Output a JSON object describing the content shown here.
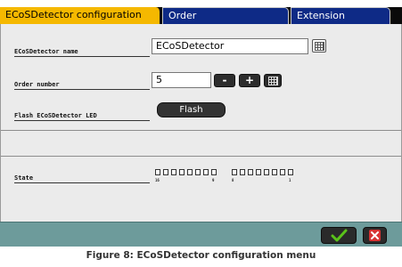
{
  "tabs": [
    {
      "label": "ECoSDetector configuration",
      "active": true
    },
    {
      "label": "Order",
      "active": false
    },
    {
      "label": "Extension",
      "active": false
    }
  ],
  "fields": {
    "name": {
      "label": "ECoSDetector name",
      "value": "ECoSDetector"
    },
    "order": {
      "label": "Order number",
      "value": "5"
    },
    "flash": {
      "label": "Flash ECoSDetector LED",
      "button_label": "Flash"
    },
    "state": {
      "label": "State",
      "led_count": 16,
      "numbers": [
        "16",
        "9",
        "8",
        "1"
      ]
    }
  },
  "buttons": {
    "minus": "-",
    "plus": "+"
  },
  "caption": "Figure 8: ECoSDetector configuration menu",
  "colors": {
    "active_tab": "#f5b800",
    "inactive_tab": "#0e2a86",
    "panel": "#ebebeb",
    "bottom_bar": "#6d9b9b",
    "ok_check": "#5ac21a",
    "cancel_x": "#d63232"
  },
  "icons": {
    "keyboard": "keyboard-icon",
    "ok": "checkmark-icon",
    "cancel": "close-icon"
  }
}
